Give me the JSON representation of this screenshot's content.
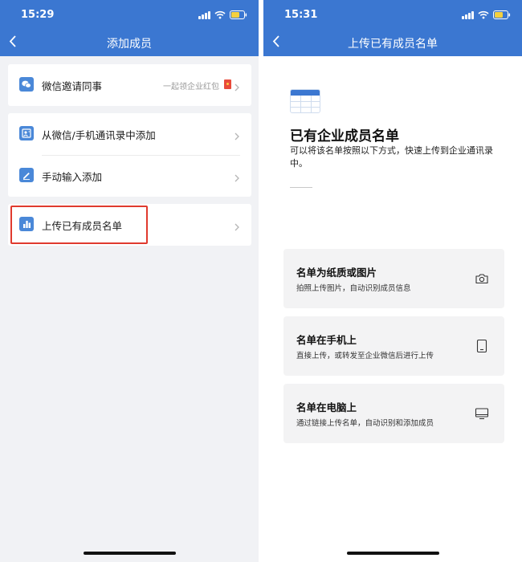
{
  "left": {
    "status_time": "15:29",
    "title": "添加成员",
    "items": [
      {
        "label": "微信邀请同事",
        "note": "一起领企业红包"
      },
      {
        "label": "从微信/手机通讯录中添加"
      },
      {
        "label": "手动输入添加"
      },
      {
        "label": "上传已有成员名单"
      }
    ]
  },
  "right": {
    "status_time": "15:31",
    "title": "上传已有成员名单",
    "hero_title": "已有企业成员名单",
    "hero_desc": "可以将该名单按照以下方式，快速上传到企业通讯录中。",
    "options": [
      {
        "title": "名单为纸质或图片",
        "subtitle": "拍照上传图片，自动识别成员信息",
        "icon": "camera-icon"
      },
      {
        "title": "名单在手机上",
        "subtitle": "直接上传，或转发至企业微信后进行上传",
        "icon": "phone-icon"
      },
      {
        "title": "名单在电脑上",
        "subtitle": "通过链接上传名单，自动识别和添加成员",
        "icon": "monitor-icon"
      }
    ]
  },
  "colors": {
    "header": "#3b77d1",
    "icon_blue": "#4a88d8",
    "highlight": "#e03a2e",
    "background": "#f1f2f5"
  }
}
